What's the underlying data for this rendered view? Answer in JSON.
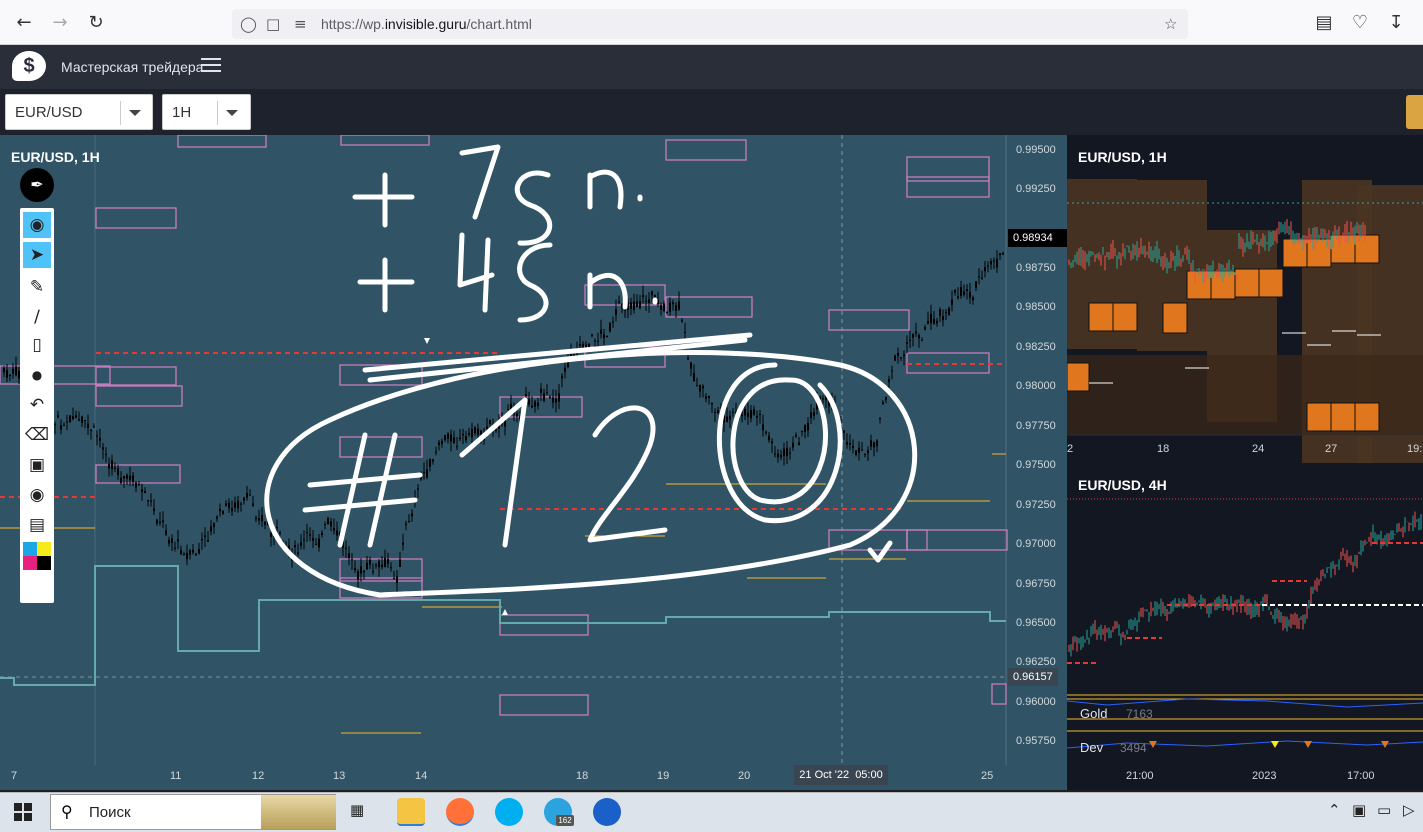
{
  "browser": {
    "url_prefix": "https://wp.",
    "url_domain": "invisible.guru",
    "url_path": "/chart.html"
  },
  "app": {
    "title": "Мастерская трейдера"
  },
  "toolbar": {
    "symbol": "EUR/USD",
    "interval": "1H"
  },
  "main_chart": {
    "title": "EUR/USD, 1H",
    "price_ticks": [
      "0.99500",
      "0.99250",
      "0.98750",
      "0.98500",
      "0.98250",
      "0.98000",
      "0.97750",
      "0.97500",
      "0.97250",
      "0.97000",
      "0.96750",
      "0.96500",
      "0.96250",
      "0.96000",
      "0.95750"
    ],
    "current_price": "0.98934",
    "crosshair_price": "0.96157",
    "time_ticks": [
      "7",
      "11",
      "12",
      "13",
      "14",
      "18",
      "19",
      "20",
      "25"
    ],
    "crosshair_time": "21 Oct '22  05:00"
  },
  "side_chart_1": {
    "title": "EUR/USD, 1H",
    "time_ticks": [
      "2",
      "18",
      "24",
      "27",
      "19:"
    ]
  },
  "side_chart_2": {
    "title": "EUR/USD, 4H",
    "time_ticks": [
      "21:00",
      "2023",
      "17:00"
    ],
    "indicators": [
      {
        "label": "Gold",
        "value": "7163"
      },
      {
        "label": "Dev",
        "value": "3494"
      }
    ]
  },
  "taskbar": {
    "search_placeholder": "Поиск",
    "telegram_badge": "162"
  },
  "colors": {
    "main_bg": "#305466",
    "side_bg": "#131722",
    "accent": "#d9a441",
    "box_pink": "#c77dbb",
    "dashed_red": "#e53935"
  }
}
